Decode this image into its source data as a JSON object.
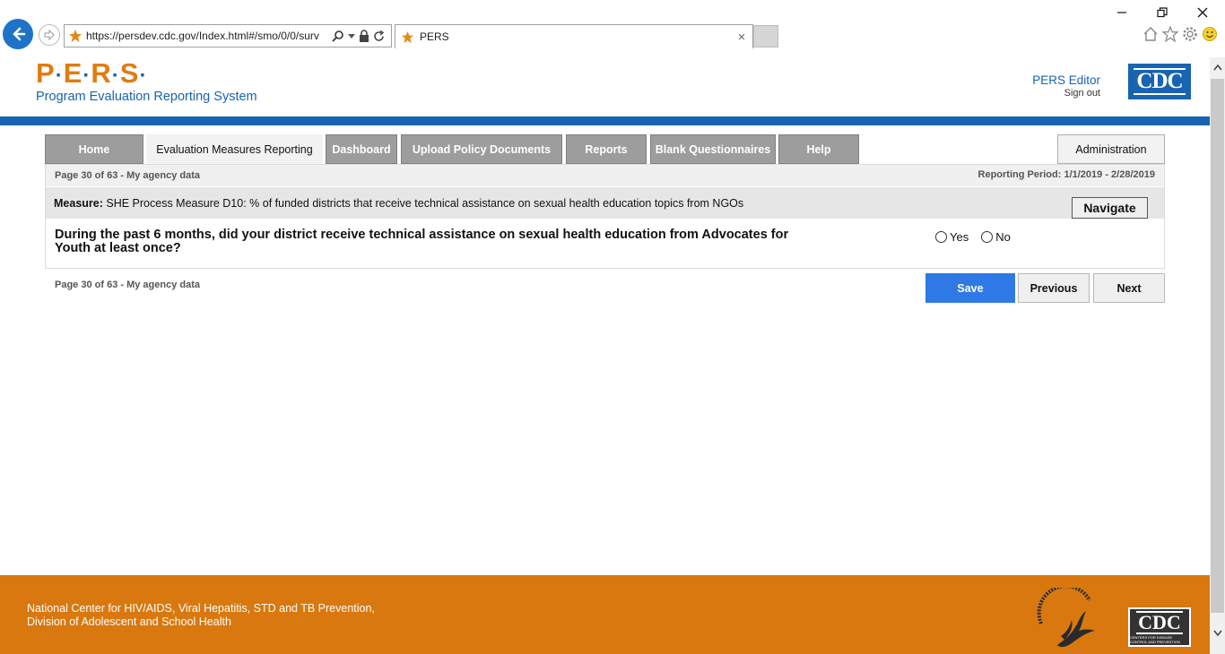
{
  "browser": {
    "url": "https://persdev.cdc.gov/Index.html#/smo/0/0/surv",
    "tab_title": "PERS",
    "tab_close": "×"
  },
  "header": {
    "logo_letters": [
      "P",
      "E",
      "R",
      "S"
    ],
    "logo_dot": "·",
    "logo_subtitle": "Program Evaluation Reporting System",
    "user_name": "PERS Editor",
    "sign_out": "Sign out",
    "cdc_logo": "CDC"
  },
  "nav": {
    "items": [
      {
        "label": "Home"
      },
      {
        "label": "Evaluation Measures Reporting"
      },
      {
        "label": "Dashboard"
      },
      {
        "label": "Upload Policy Documents"
      },
      {
        "label": "Reports"
      },
      {
        "label": "Blank Questionnaires"
      },
      {
        "label": "Help"
      }
    ],
    "admin_label": "Administration"
  },
  "content": {
    "page_info": "Page 30 of 63 - My agency data",
    "reporting_period": "Reporting Period: 1/1/2019 - 2/28/2019",
    "measure_label": "Measure:",
    "measure_text": "SHE Process Measure D10: % of funded districts that receive technical assistance on sexual health education topics from NGOs",
    "navigate_label": "Navigate",
    "question": "During the past 6 months, did your district receive technical assistance on sexual health education from Advocates for Youth at least once?",
    "options": [
      "Yes",
      "No"
    ],
    "page_info_bottom": "Page 30 of 63 - My agency data",
    "save_label": "Save",
    "previous_label": "Previous",
    "next_label": "Next"
  },
  "footer": {
    "line1": "National Center for HIV/AIDS, Viral Hepatitis, STD and TB Prevention,",
    "line2": "Division of Adolescent and School Health",
    "cdc_logo": "CDC",
    "cdc_tagline": "CENTERS FOR DISEASE CONTROL AND PREVENTION"
  },
  "colors": {
    "brand_orange": "#d9780f",
    "brand_blue": "#1863b2",
    "save_blue": "#2e79e6"
  }
}
